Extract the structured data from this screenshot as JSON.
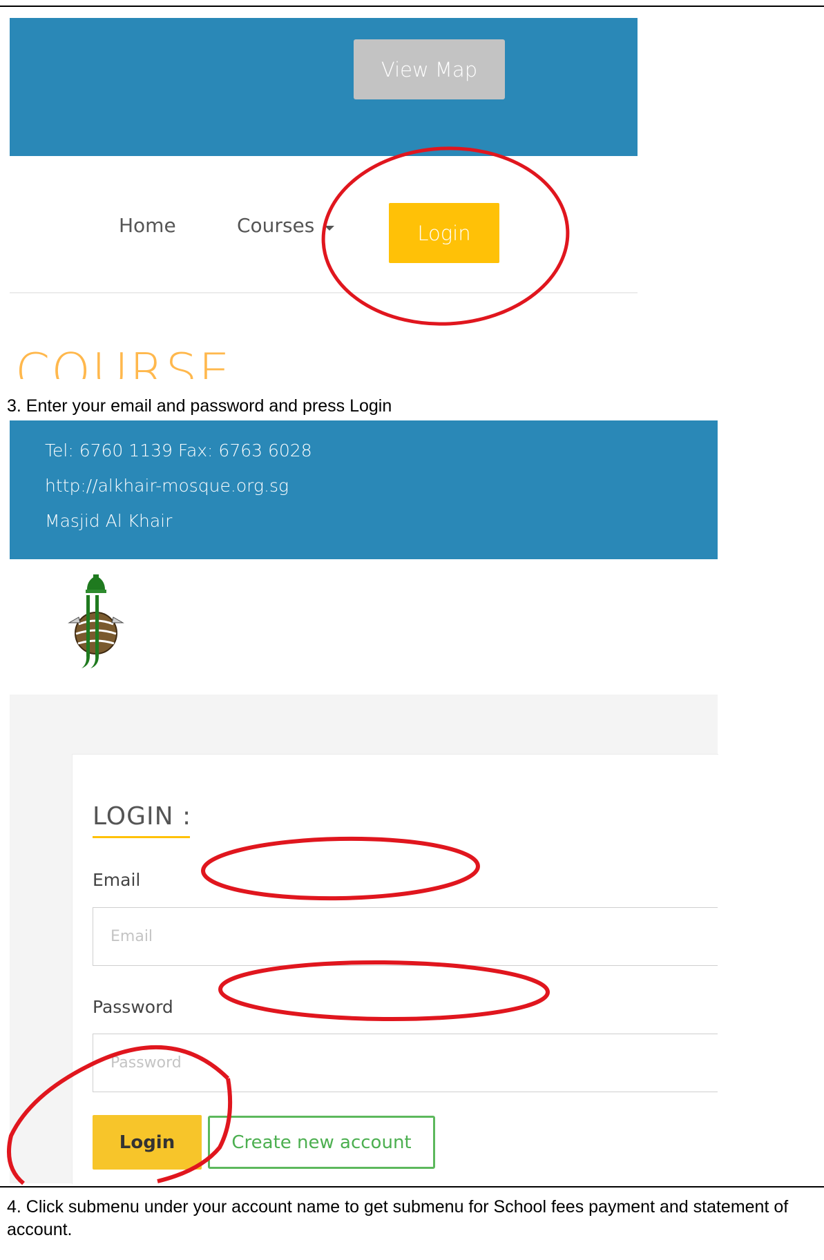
{
  "panel1": {
    "view_map_label": "View Map",
    "nav": {
      "home": "Home",
      "courses": "Courses",
      "login": "Login"
    },
    "course_heading": "COURSE"
  },
  "step3_text": "3. Enter your email and password and press Login",
  "panel2": {
    "contact": {
      "tel_fax": "Tel: 6760 1139 Fax: 6763 6028",
      "website": "http://alkhair-mosque.org.sg",
      "name": "Masjid Al Khair"
    },
    "login_form": {
      "title": "LOGIN :",
      "email_label": "Email",
      "email_placeholder": "Email",
      "password_label": "Password",
      "password_placeholder": "Password",
      "submit_label": "Login",
      "create_account_label": "Create new account"
    }
  },
  "step4_text": "4. Click submenu under your account name to get submenu for School fees payment and statement of account.",
  "colors": {
    "banner": "#2a88b7",
    "login_yellow": "#ffc107",
    "annotation_red": "#e0161e",
    "create_green": "#5cb85c"
  }
}
